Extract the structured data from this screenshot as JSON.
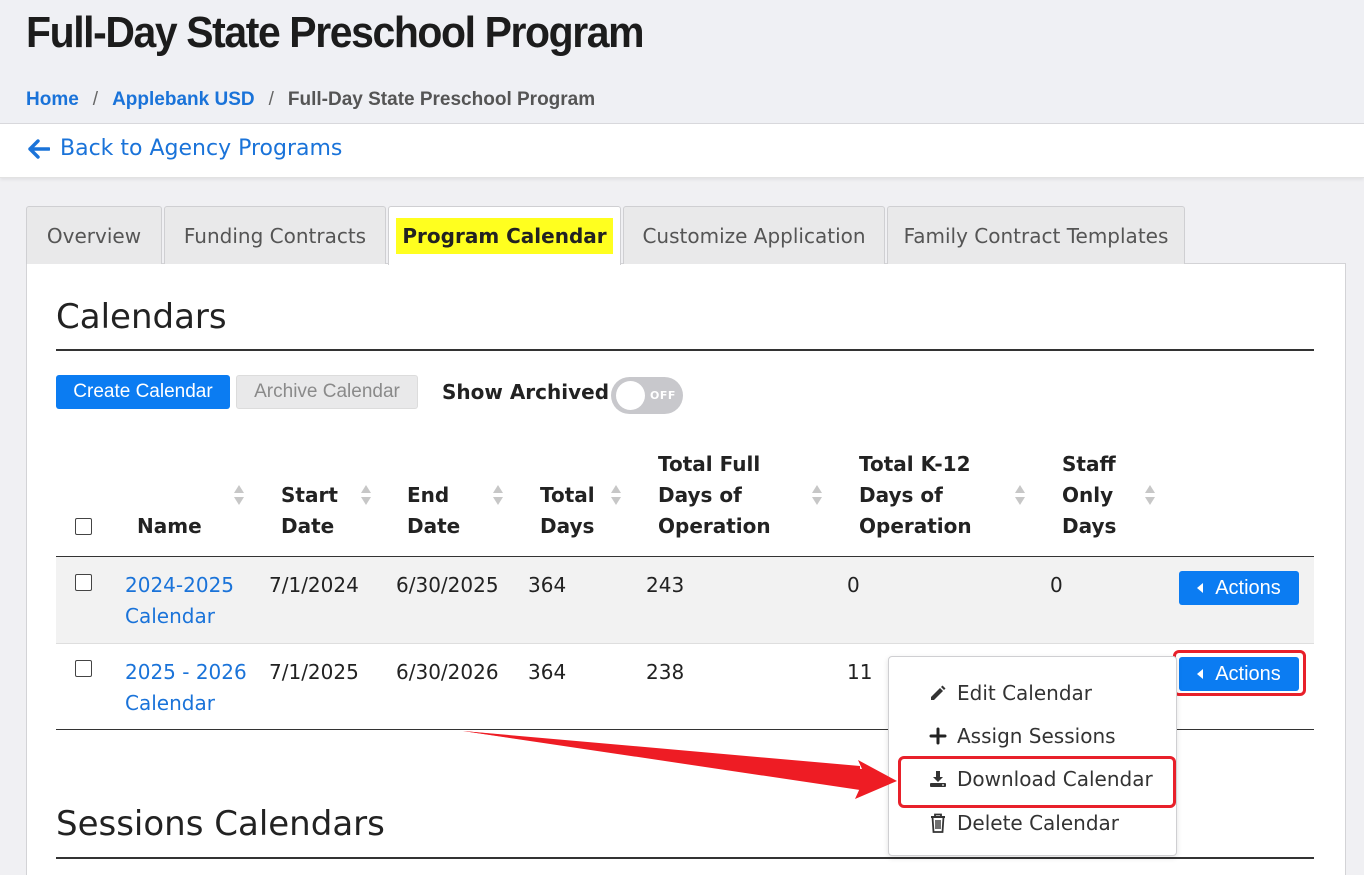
{
  "header": {
    "title": "Full-Day State Preschool Program",
    "breadcrumb": [
      {
        "label": "Home"
      },
      {
        "label": "Applebank USD"
      },
      {
        "label": "Full-Day State Preschool Program"
      }
    ],
    "separator": "/"
  },
  "back_link": {
    "label": "Back to Agency Programs",
    "icon": "arrow-left-icon"
  },
  "tabs": [
    {
      "label": "Overview"
    },
    {
      "label": "Funding Contracts"
    },
    {
      "label": "Program Calendar",
      "active": true
    },
    {
      "label": "Customize Application"
    },
    {
      "label": "Family Contract Templates"
    }
  ],
  "calendars": {
    "heading": "Calendars",
    "create_button": "Create Calendar",
    "archive_button": "Archive Calendar",
    "show_archived_label": "Show Archived",
    "toggle_state": "OFF",
    "columns": {
      "name": "Name",
      "start_date_1": "Start",
      "start_date_2": "Date",
      "end_date_1": "End",
      "end_date_2": "Date",
      "total_days_1": "Total",
      "total_days_2": "Days",
      "full_days_1": "Total Full",
      "full_days_2": "Days of",
      "full_days_3": "Operation",
      "k12_days_1": "Total K-12",
      "k12_days_2": "Days of",
      "k12_days_3": "Operation",
      "staff_days_1": "Staff",
      "staff_days_2": "Only",
      "staff_days_3": "Days"
    },
    "rows": [
      {
        "name_1": "2024-2025",
        "name_2": "Calendar",
        "start": "7/1/2024",
        "end": "6/30/2025",
        "total": "364",
        "full": "243",
        "k12": "0",
        "staff": "0",
        "actions": "Actions"
      },
      {
        "name_1": "2025 - 2026",
        "name_2": "Calendar",
        "start": "7/1/2025",
        "end": "6/30/2026",
        "total": "364",
        "full": "238",
        "k12": "11",
        "actions": "Actions"
      }
    ]
  },
  "actions_menu": [
    {
      "label": "Edit Calendar",
      "icon": "pencil-icon"
    },
    {
      "label": "Assign Sessions",
      "icon": "plus-icon"
    },
    {
      "label": "Download Calendar",
      "icon": "download-icon"
    },
    {
      "label": "Delete Calendar",
      "icon": "trash-icon"
    }
  ],
  "sessions": {
    "heading": "Sessions Calendars"
  },
  "colors": {
    "accent": "#0b7cf2",
    "link": "#1a73d9",
    "highlight": "#ffff1f",
    "annotation": "#e8202a"
  }
}
